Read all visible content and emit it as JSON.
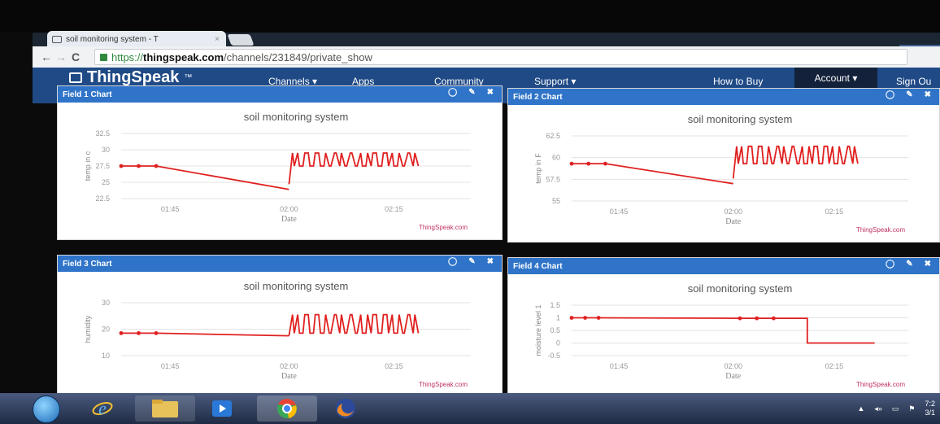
{
  "browser": {
    "tab_title": "soil monitoring system - T",
    "tab_close": "×",
    "url_scheme": "https://",
    "url_domain": "thingspeak.com",
    "url_path": "/channels/231849/private_show",
    "window_control": "– □"
  },
  "site": {
    "logo": "ThingSpeak",
    "logo_tm": "™",
    "nav": [
      "Channels ▾",
      "Apps",
      "Community",
      "Support ▾"
    ],
    "how_to_buy": "How to Buy",
    "account": "Account ▾",
    "sign_out": "Sign Ou"
  },
  "colors": {
    "header": "#1f4a86",
    "panel_header": "#2f74c8",
    "line": "#e02020",
    "account": "#13213a"
  },
  "panels": [
    {
      "title": "Field 1 Chart",
      "icons": [
        "comment-icon",
        "edit-icon",
        "close-icon"
      ]
    },
    {
      "title": "Field 2 Chart",
      "icons": [
        "comment-icon",
        "edit-icon",
        "close-icon"
      ]
    },
    {
      "title": "Field 3 Chart",
      "icons": [
        "comment-icon",
        "edit-icon",
        "close-icon"
      ]
    },
    {
      "title": "Field 4 Chart",
      "icons": [
        "comment-icon",
        "edit-icon",
        "close-icon"
      ]
    }
  ],
  "chart_data": [
    {
      "type": "line",
      "title": "soil monitoring system",
      "xlabel": "Date",
      "ylabel": "temp in c",
      "yticks": [
        "32.5",
        "30",
        "27.5",
        "25",
        "22.5"
      ],
      "ylim": [
        22.5,
        32.5
      ],
      "xticks": [
        "01:45",
        "02:00",
        "02:15"
      ],
      "credit": "ThingSpeak.com",
      "segments": [
        {
          "x": [
            0.0,
            0.05,
            0.1,
            0.48
          ],
          "y": [
            27.5,
            27.5,
            27.5,
            23.9
          ]
        },
        {
          "x": [
            0.48,
            0.49,
            0.495,
            0.505,
            0.51,
            0.52,
            0.525,
            0.535,
            0.54,
            0.55,
            0.555,
            0.565,
            0.57,
            0.58,
            0.585,
            0.595,
            0.6,
            0.61,
            0.615,
            0.625,
            0.63,
            0.64,
            0.645,
            0.655,
            0.66,
            0.67,
            0.675,
            0.685,
            0.69,
            0.7,
            0.705,
            0.715,
            0.72,
            0.73,
            0.735,
            0.745,
            0.75,
            0.76,
            0.765,
            0.775,
            0.78,
            0.79,
            0.795,
            0.805,
            0.81,
            0.82,
            0.825,
            0.835,
            0.84,
            0.85
          ],
          "y": [
            24.7,
            29.5,
            27.5,
            29.5,
            27.5,
            27.5,
            29.5,
            29.5,
            27.5,
            27.5,
            29.5,
            29.5,
            27.5,
            27.5,
            29.5,
            27.5,
            27.5,
            29.5,
            29.5,
            27.5,
            29.5,
            27.5,
            27.5,
            29.5,
            29.5,
            27.5,
            27.5,
            29.5,
            27.5,
            27.5,
            29.5,
            27.5,
            29.5,
            29.5,
            27.5,
            27.5,
            29.5,
            29.5,
            27.5,
            29.5,
            27.5,
            27.5,
            29.5,
            27.5,
            27.5,
            29.5,
            29.5,
            27.5,
            29.5,
            27.5
          ]
        }
      ],
      "markers": [
        {
          "x": [
            0.0,
            0.05,
            0.1
          ],
          "y": [
            27.5,
            27.5,
            27.5
          ]
        }
      ]
    },
    {
      "type": "line",
      "title": "soil monitoring system",
      "xlabel": "Date",
      "ylabel": "temp in F",
      "yticks": [
        "62.5",
        "60",
        "57.5",
        "55"
      ],
      "ylim": [
        55,
        62.5
      ],
      "xticks": [
        "01:45",
        "02:00",
        "02:15"
      ],
      "credit": "ThingSpeak.com",
      "segments": [
        {
          "x": [
            0.0,
            0.05,
            0.1,
            0.48
          ],
          "y": [
            59.3,
            59.3,
            59.3,
            57.0
          ]
        },
        {
          "x": [
            0.48,
            0.49,
            0.495,
            0.505,
            0.51,
            0.52,
            0.525,
            0.535,
            0.54,
            0.55,
            0.555,
            0.565,
            0.57,
            0.58,
            0.585,
            0.595,
            0.6,
            0.61,
            0.615,
            0.625,
            0.63,
            0.64,
            0.645,
            0.655,
            0.66,
            0.67,
            0.675,
            0.685,
            0.69,
            0.7,
            0.705,
            0.715,
            0.72,
            0.73,
            0.735,
            0.745,
            0.75,
            0.76,
            0.765,
            0.775,
            0.78,
            0.79,
            0.795,
            0.805,
            0.81,
            0.82,
            0.825,
            0.835,
            0.84,
            0.85
          ],
          "y": [
            57.6,
            61.3,
            59.3,
            61.3,
            59.3,
            59.3,
            61.3,
            61.3,
            59.3,
            59.3,
            61.3,
            61.3,
            59.3,
            59.3,
            61.3,
            59.3,
            59.3,
            61.3,
            61.3,
            59.3,
            61.3,
            59.3,
            59.3,
            61.3,
            61.3,
            59.3,
            59.3,
            61.3,
            59.3,
            59.3,
            61.3,
            59.3,
            61.3,
            61.3,
            59.3,
            59.3,
            61.3,
            61.3,
            59.3,
            61.3,
            59.3,
            59.3,
            61.3,
            59.3,
            59.3,
            61.3,
            61.3,
            59.3,
            61.3,
            59.3
          ]
        }
      ],
      "markers": [
        {
          "x": [
            0.0,
            0.05,
            0.1
          ],
          "y": [
            59.3,
            59.3,
            59.3
          ]
        }
      ]
    },
    {
      "type": "line",
      "title": "soil monitoring system",
      "xlabel": "Date",
      "ylabel": "humidity",
      "yticks": [
        "30",
        "20",
        "10"
      ],
      "ylim": [
        10,
        30
      ],
      "xticks": [
        "01:45",
        "02:00",
        "02:15"
      ],
      "credit": "ThingSpeak.com",
      "segments": [
        {
          "x": [
            0.0,
            0.05,
            0.1,
            0.48
          ],
          "y": [
            18.5,
            18.5,
            18.5,
            17.5
          ]
        },
        {
          "x": [
            0.48,
            0.49,
            0.495,
            0.505,
            0.51,
            0.52,
            0.525,
            0.535,
            0.54,
            0.55,
            0.555,
            0.565,
            0.57,
            0.58,
            0.585,
            0.595,
            0.6,
            0.61,
            0.615,
            0.625,
            0.63,
            0.64,
            0.645,
            0.655,
            0.66,
            0.67,
            0.675,
            0.685,
            0.69,
            0.7,
            0.705,
            0.715,
            0.72,
            0.73,
            0.735,
            0.745,
            0.75,
            0.76,
            0.765,
            0.775,
            0.78,
            0.79,
            0.795,
            0.805,
            0.81,
            0.82,
            0.825,
            0.835,
            0.84,
            0.85
          ],
          "y": [
            17.5,
            25.5,
            18.5,
            25.5,
            18.5,
            18.5,
            25.5,
            25.5,
            18.5,
            18.5,
            25.5,
            25.5,
            18.5,
            18.5,
            25.5,
            18.5,
            18.5,
            25.5,
            25.5,
            18.5,
            25.5,
            18.5,
            18.5,
            25.5,
            25.5,
            18.5,
            18.5,
            25.5,
            18.5,
            18.5,
            25.5,
            18.5,
            25.5,
            25.5,
            18.5,
            18.5,
            25.5,
            25.5,
            18.5,
            25.5,
            18.5,
            18.5,
            25.5,
            18.5,
            18.5,
            25.5,
            25.5,
            18.5,
            25.5,
            18.5
          ]
        }
      ],
      "markers": [
        {
          "x": [
            0.0,
            0.05,
            0.1
          ],
          "y": [
            18.5,
            18.5,
            18.5
          ]
        }
      ]
    },
    {
      "type": "line",
      "title": "soil monitoring system",
      "xlabel": "Date",
      "ylabel": "moisture level 1",
      "yticks": [
        "1.5",
        "1",
        "0.5",
        "0",
        "-0.5"
      ],
      "ylim": [
        -0.5,
        1.5
      ],
      "xticks": [
        "01:45",
        "02:00",
        "02:15"
      ],
      "credit": "ThingSpeak.com",
      "segments": [
        {
          "x": [
            0.0,
            0.04,
            0.08,
            0.5,
            0.55,
            0.6,
            0.7,
            0.7,
            0.75,
            0.9
          ],
          "y": [
            1,
            1,
            1,
            0.98,
            0.98,
            0.98,
            0.98,
            0,
            0,
            0
          ]
        }
      ],
      "markers": [
        {
          "x": [
            0.0,
            0.04,
            0.08,
            0.5,
            0.55,
            0.6
          ],
          "y": [
            1,
            1,
            1,
            0.98,
            0.98,
            0.98
          ]
        }
      ]
    }
  ],
  "taskbar": {
    "apps": [
      "windows-start",
      "internet-explorer",
      "file-explorer",
      "media-player",
      "chrome",
      "firefox"
    ],
    "tray_arrow": "▲",
    "tray_speaker": "◂»",
    "tray_network": "▭",
    "tray_flag": "⚑",
    "clock_time": "7:2",
    "clock_date": "3/1"
  }
}
